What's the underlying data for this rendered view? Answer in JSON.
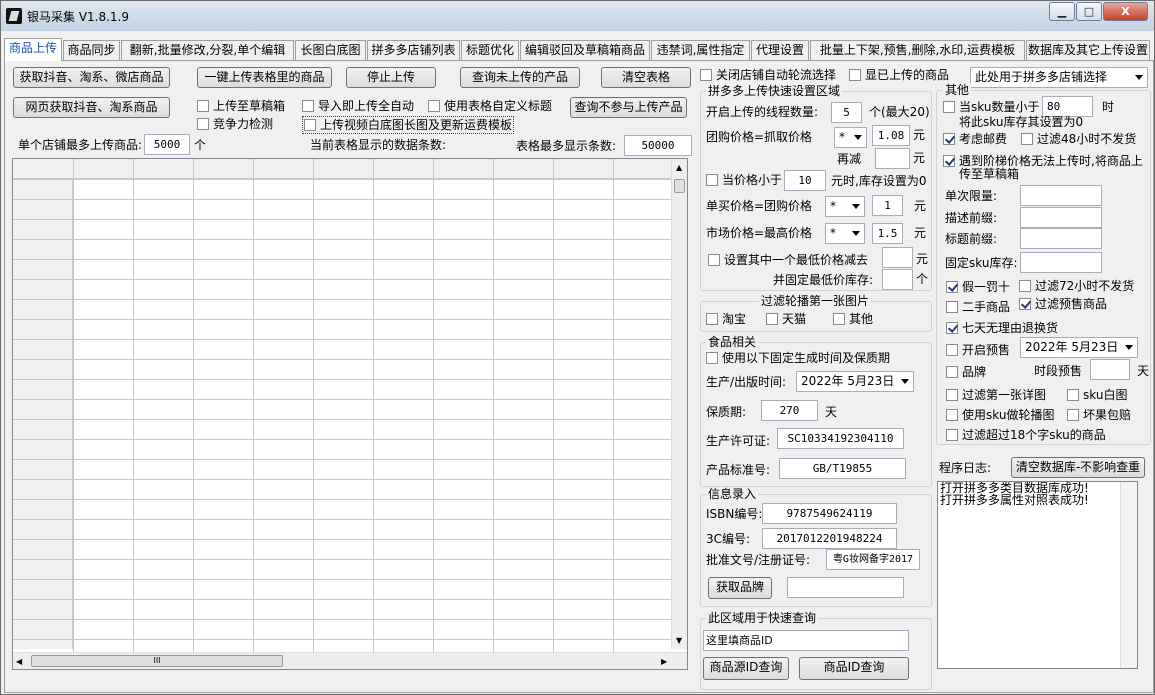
{
  "window": {
    "title": "银马采集 V1.8.1.9",
    "min_label": "▁",
    "max_label": "□",
    "close_label": "X"
  },
  "tabs": [
    "商品上传",
    "商品同步",
    "翻新,批量修改,分裂,单个编辑",
    "长图白底图",
    "拼多多店铺列表",
    "标题优化",
    "编辑驳回及草稿箱商品",
    "违禁词,属性指定",
    "代理设置",
    "批量上下架,预售,删除,水印,运费模板",
    "数据库及其它上传设置"
  ],
  "left": {
    "btn_fetch": "获取抖音、淘系、微店商品",
    "btn_upload_all": "一键上传表格里的商品",
    "btn_stop": "停止上传",
    "btn_query_unuploaded": "查询未上传的产品",
    "btn_clear": "清空表格",
    "btn_web_fetch": "网页获取抖音、淘系商品",
    "btn_query_not_uploaded": "查询不参与上传产品",
    "cb_draft": "上传至草稿箱",
    "cb_import_auto": "导入即上传全自动",
    "cb_custom_title": "使用表格自定义标题",
    "cb_compete": "竞争力检测",
    "cb_video": "上传视频白底图长图及更新运费模板",
    "max_per_shop_label": "单个店铺最多上传商品:",
    "max_per_shop_value": "5000",
    "max_per_shop_unit": "个",
    "current_rows_label": "当前表格显示的数据条数:",
    "max_rows_label": "表格最多显示条数:",
    "max_rows_value": "50000",
    "grid_scroll_mark": "III"
  },
  "mid": {
    "cb_close_rotate": "关闭店铺自动轮流选择",
    "cb_show_uploaded": "显已上传的商品",
    "shop_select": "此处用于拼多多店铺选择",
    "quick_group": "拼多多上传快速设置区域",
    "threads_label": "开启上传的线程数量:",
    "threads_value": "5",
    "threads_hint": "个(最大20)",
    "group_price_label": "团购价格=抓取价格",
    "group_price_op": "*",
    "group_price_value": "1.08",
    "yuan": "元",
    "minus_label": "再减",
    "cb_price_lt": "当价格小于",
    "price_lt_value": "10",
    "price_lt_hint": "元时,库存设置为0",
    "single_price_label": "单买价格=团购价格",
    "single_op": "*",
    "single_value": "1",
    "market_price_label": "市场价格=最高价格",
    "market_op": "*",
    "market_value": "1.5",
    "cb_lowest": "设置其中一个最低价格减去",
    "fix_stock_label": "并固定最低价库存:",
    "ge": "个",
    "filter_group": "过滤轮播第一张图片",
    "cb_taobao": "淘宝",
    "cb_tmall": "天猫",
    "cb_other": "其他",
    "food_group": "食品相关",
    "cb_fixed_date": "使用以下固定生成时间及保质期",
    "prod_date_label": "生产/出版时间:",
    "prod_date_value": "2022年 5月23日",
    "shelf_label": "保质期:",
    "shelf_value": "270",
    "shelf_unit": "天",
    "license_label": "生产许可证:",
    "license_value": "SC10334192304110",
    "standard_label": "产品标准号:",
    "standard_value": "GB/T19855",
    "info_group": "信息录入",
    "isbn_label": "ISBN编号:",
    "isbn_value": "9787549624119",
    "cc_label": "3C编号:",
    "cc_value": "2017012201948224",
    "approval_label": "批准文号/注册证号:",
    "approval_value": "粤G妆网备字2017",
    "btn_brand": "获取品牌",
    "quick_query_group": "此区域用于快速查询",
    "query_input": "这里填商品ID",
    "btn_src_query": "商品源ID查询",
    "btn_id_query": "商品ID查询"
  },
  "right": {
    "other_group": "其他",
    "cb_sku_lt": "当sku数量小于",
    "sku_lt_value": "80",
    "sku_lt_unit": "时",
    "sku_lt_hint": "将此sku库存其设置为0",
    "cb_remote": "考虑邮费",
    "cb_48h": "过滤48小时不发货",
    "cb_ladder": "遇到阶梯价格无法上传时,将商品上传至草稿箱",
    "limit_label": "单次限量:",
    "desc_prefix_label": "描述前缀:",
    "title_prefix_label": "标题前缀:",
    "fixed_sku_label": "固定sku库存:",
    "cb_fake": "假一罚十",
    "cb_72h": "过滤72小时不发货",
    "cb_secondhand": "二手商品",
    "cb_presale": "过滤预售商品",
    "cb_7day": "七天无理由退换货",
    "cb_open_presale": "开启预售",
    "presale_date": "2022年 5月23日",
    "cb_brand": "品牌",
    "period_presale_label": "时段预售",
    "day": "天",
    "cb_filter_first": "过滤第一张详图",
    "cb_sku_white": "sku白图",
    "cb_sku_carousel": "使用sku做轮播图",
    "cb_bad_fruit": "坏果包赔",
    "cb_over18": "过滤超过18个字sku的商品",
    "log_label": "程序日志:",
    "btn_clear_db": "清空数据库-不影响查重",
    "log_lines": [
      "打开拼多多类目数据库成功!",
      "打开拼多多属性对照表成功!"
    ]
  }
}
